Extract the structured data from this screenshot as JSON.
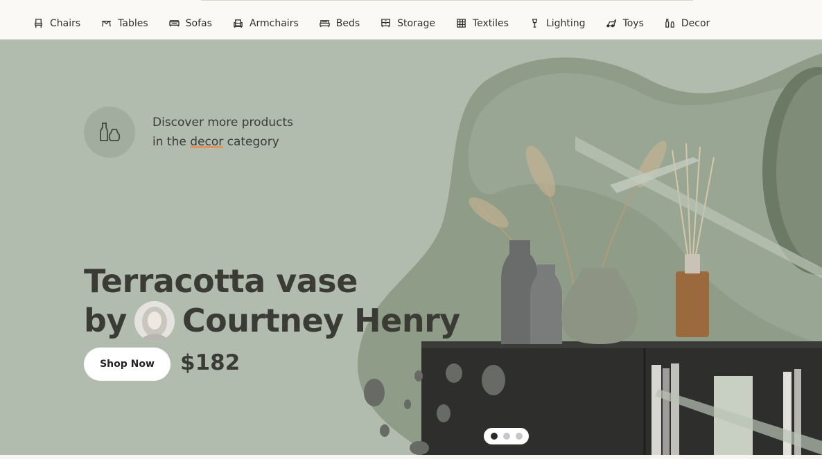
{
  "nav": {
    "items": [
      {
        "label": "Chairs",
        "icon": "chair-icon"
      },
      {
        "label": "Tables",
        "icon": "table-icon"
      },
      {
        "label": "Sofas",
        "icon": "sofa-icon"
      },
      {
        "label": "Armchairs",
        "icon": "armchair-icon"
      },
      {
        "label": "Beds",
        "icon": "bed-icon"
      },
      {
        "label": "Storage",
        "icon": "storage-icon"
      },
      {
        "label": "Textiles",
        "icon": "textile-icon"
      },
      {
        "label": "Lighting",
        "icon": "lamp-icon"
      },
      {
        "label": "Toys",
        "icon": "toy-icon"
      },
      {
        "label": "Decor",
        "icon": "vase-icon"
      }
    ]
  },
  "hero": {
    "category_line1": "Discover more products",
    "category_prefix": "in the ",
    "category_name": "decor",
    "category_suffix": " category",
    "category_icon": "vase-icon",
    "title_line1": "Terracotta vase",
    "title_by": "by",
    "designer": "Courtney Henry",
    "cta_label": "Shop Now",
    "price": "$182",
    "slides": {
      "count": 3,
      "active": 1
    }
  },
  "colors": {
    "hero_bg": "#b2bcae",
    "accent_underline": "#e0955f",
    "text_dark": "#3a3b35"
  }
}
